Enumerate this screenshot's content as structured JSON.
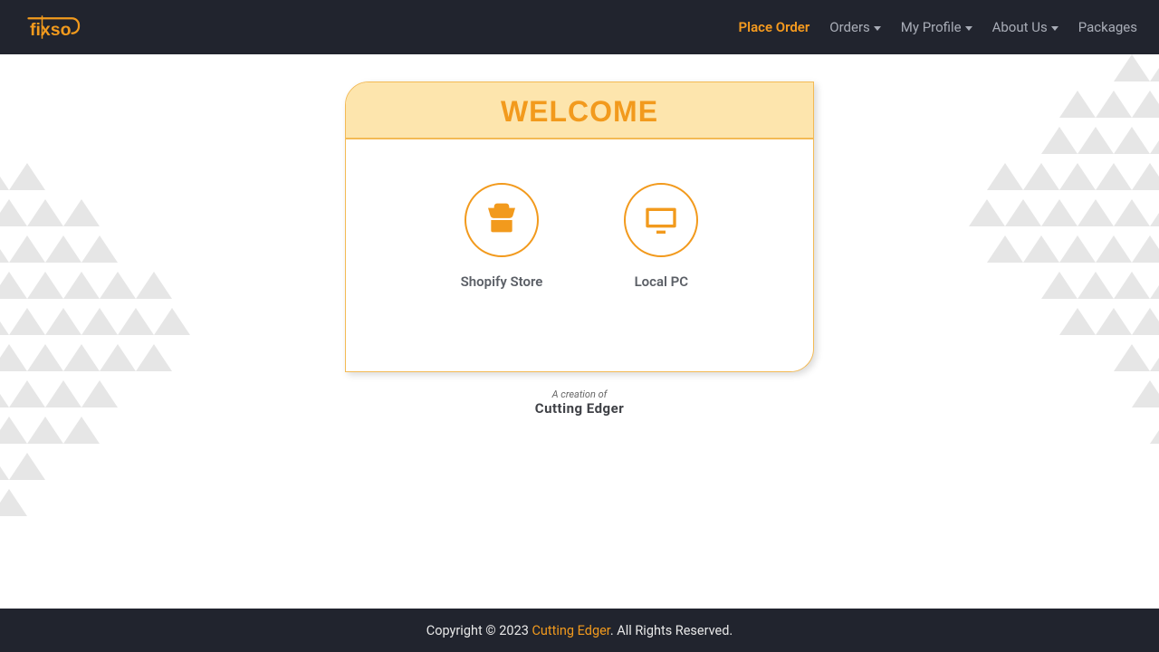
{
  "brand": {
    "name": "fixso"
  },
  "nav": {
    "place_order": "Place Order",
    "orders": "Orders",
    "my_profile": "My Profile",
    "about_us": "About Us",
    "packages": "Packages"
  },
  "card": {
    "title": "WELCOME",
    "options": {
      "shopify": "Shopify Store",
      "local_pc": "Local PC"
    }
  },
  "credit": {
    "line1": "A creation of",
    "line2": "Cutting  Edger"
  },
  "footer": {
    "prefix": "Copyright © 2023 ",
    "brand": "Cutting Edger",
    "suffix": ". All Rights Reserved."
  },
  "colors": {
    "accent": "#f29a1d",
    "header_bg": "#21242e"
  }
}
